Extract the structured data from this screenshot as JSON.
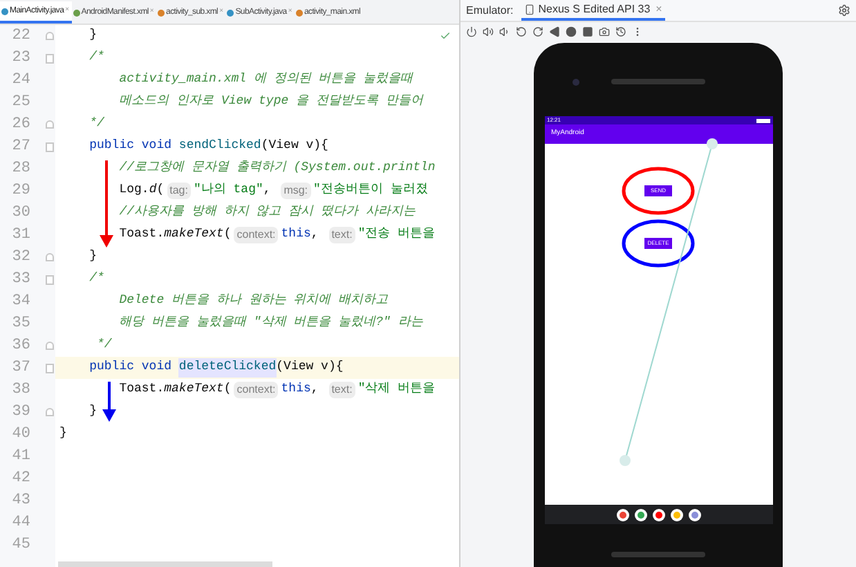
{
  "editor": {
    "tabs": [
      {
        "label": "MainActivity.java",
        "kind": "java",
        "selected": true,
        "close": "×"
      },
      {
        "label": "AndroidManifest.xml",
        "kind": "manifest",
        "selected": false,
        "close": "×"
      },
      {
        "label": "activity_sub.xml",
        "kind": "layout",
        "selected": false,
        "close": "×"
      },
      {
        "label": "SubActivity.java",
        "kind": "java",
        "selected": false,
        "close": "×"
      },
      {
        "label": "activity_main.xml",
        "kind": "layout",
        "selected": false
      }
    ],
    "lines": [
      {
        "number": "22",
        "fold_start": false,
        "fold_end": true,
        "current": false,
        "tokens": [
          {
            "kind": "plain",
            "text": "    }"
          }
        ]
      },
      {
        "number": "23",
        "fold_start": true,
        "fold_end": false,
        "current": false,
        "tokens": [
          {
            "kind": "doc",
            "text": "    /*"
          }
        ]
      },
      {
        "number": "24",
        "fold_start": false,
        "fold_end": false,
        "current": false,
        "tokens": [
          {
            "kind": "doc",
            "text": "        activity_main.xml 에 정의된 버튼을 눌렀을때"
          }
        ]
      },
      {
        "number": "25",
        "fold_start": false,
        "fold_end": false,
        "current": false,
        "tokens": [
          {
            "kind": "doc",
            "text": "        메소드의 인자로 View type 을 전달받도록 만들어"
          }
        ]
      },
      {
        "number": "26",
        "fold_start": false,
        "fold_end": true,
        "current": false,
        "tokens": [
          {
            "kind": "doc",
            "text": "    */"
          }
        ]
      },
      {
        "number": "27",
        "fold_start": true,
        "fold_end": false,
        "current": false,
        "tokens": [
          {
            "kind": "keyword",
            "text": "    public void "
          },
          {
            "kind": "method",
            "text": "sendClicked"
          },
          {
            "kind": "plain",
            "text": "(View v){"
          }
        ]
      },
      {
        "number": "28",
        "fold_start": false,
        "fold_end": false,
        "current": false,
        "tokens": [
          {
            "kind": "doc",
            "text": "        //로그창에 문자열 출력하기 (System.out.println"
          }
        ]
      },
      {
        "number": "29",
        "fold_start": false,
        "fold_end": false,
        "current": false,
        "tokens": [
          {
            "kind": "plain",
            "text": "        Log."
          },
          {
            "kind": "italic",
            "text": "d"
          },
          {
            "kind": "plain",
            "text": "("
          },
          {
            "kind": "hint",
            "text": "tag:"
          },
          {
            "kind": "string",
            "text": "\"나의 tag\""
          },
          {
            "kind": "plain",
            "text": ", "
          },
          {
            "kind": "hint",
            "text": "msg:"
          },
          {
            "kind": "string",
            "text": "\"전송버튼이 눌러졌"
          }
        ]
      },
      {
        "number": "30",
        "fold_start": false,
        "fold_end": false,
        "current": false,
        "tokens": [
          {
            "kind": "doc",
            "text": "        //사용자를 방해 하지 않고 잠시 떴다가 사라지는"
          }
        ]
      },
      {
        "number": "31",
        "fold_start": false,
        "fold_end": false,
        "current": false,
        "tokens": [
          {
            "kind": "plain",
            "text": "        Toast."
          },
          {
            "kind": "italic",
            "text": "makeText"
          },
          {
            "kind": "plain",
            "text": "("
          },
          {
            "kind": "hint",
            "text": "context:"
          },
          {
            "kind": "keyword",
            "text": "this"
          },
          {
            "kind": "plain",
            "text": ", "
          },
          {
            "kind": "hint",
            "text": "text:"
          },
          {
            "kind": "string",
            "text": "\"전송 버튼을"
          }
        ]
      },
      {
        "number": "32",
        "fold_start": false,
        "fold_end": true,
        "current": false,
        "tokens": [
          {
            "kind": "plain",
            "text": "    }"
          }
        ]
      },
      {
        "number": "33",
        "fold_start": true,
        "fold_end": false,
        "current": false,
        "tokens": [
          {
            "kind": "doc",
            "text": "    /*"
          }
        ]
      },
      {
        "number": "34",
        "fold_start": false,
        "fold_end": false,
        "current": false,
        "tokens": [
          {
            "kind": "doc",
            "text": "        Delete 버튼을 하나 원하는 위치에 배치하고"
          }
        ]
      },
      {
        "number": "35",
        "fold_start": false,
        "fold_end": false,
        "current": false,
        "tokens": [
          {
            "kind": "doc",
            "text": "        해당 버튼을 눌렀을때 \"삭제 버튼을 눌렀네?\" 라는"
          }
        ]
      },
      {
        "number": "36",
        "fold_start": false,
        "fold_end": true,
        "current": false,
        "tokens": [
          {
            "kind": "doc",
            "text": "     */"
          }
        ]
      },
      {
        "number": "37",
        "fold_start": true,
        "fold_end": false,
        "current": true,
        "tokens": [
          {
            "kind": "keyword",
            "text": "    public void "
          },
          {
            "kind": "method_marked",
            "text": "deleteClicked"
          },
          {
            "kind": "plain",
            "text": "(View v){"
          }
        ]
      },
      {
        "number": "38",
        "fold_start": false,
        "fold_end": false,
        "current": false,
        "tokens": [
          {
            "kind": "plain",
            "text": "        Toast."
          },
          {
            "kind": "italic",
            "text": "makeText"
          },
          {
            "kind": "plain",
            "text": "("
          },
          {
            "kind": "hint",
            "text": "context:"
          },
          {
            "kind": "keyword",
            "text": "this"
          },
          {
            "kind": "plain",
            "text": ", "
          },
          {
            "kind": "hint",
            "text": "text:"
          },
          {
            "kind": "string",
            "text": "\"삭제 버튼을"
          }
        ]
      },
      {
        "number": "39",
        "fold_start": false,
        "fold_end": true,
        "current": false,
        "tokens": [
          {
            "kind": "plain",
            "text": "    }"
          }
        ]
      },
      {
        "number": "40",
        "fold_start": false,
        "fold_end": false,
        "current": false,
        "tokens": [
          {
            "kind": "plain",
            "text": "}"
          }
        ]
      },
      {
        "number": "41",
        "fold_start": false,
        "fold_end": false,
        "current": false
      },
      {
        "number": "42",
        "fold_start": false,
        "fold_end": false,
        "current": false
      },
      {
        "number": "43",
        "fold_start": false,
        "fold_end": false,
        "current": false
      },
      {
        "number": "44",
        "fold_start": false,
        "fold_end": false,
        "current": false
      },
      {
        "number": "45",
        "fold_start": false,
        "fold_end": false,
        "current": false
      }
    ]
  },
  "emulator": {
    "label": "Emulator:",
    "device_tab": {
      "label": "Nexus S Edited API 33",
      "close": "×"
    },
    "phone": {
      "time": "12:21",
      "app_title": "MyAndroid",
      "buttons": [
        {
          "label": "SEND",
          "color": "#ff0000"
        },
        {
          "label": "DELETE",
          "color": "#0000ff"
        }
      ]
    }
  }
}
